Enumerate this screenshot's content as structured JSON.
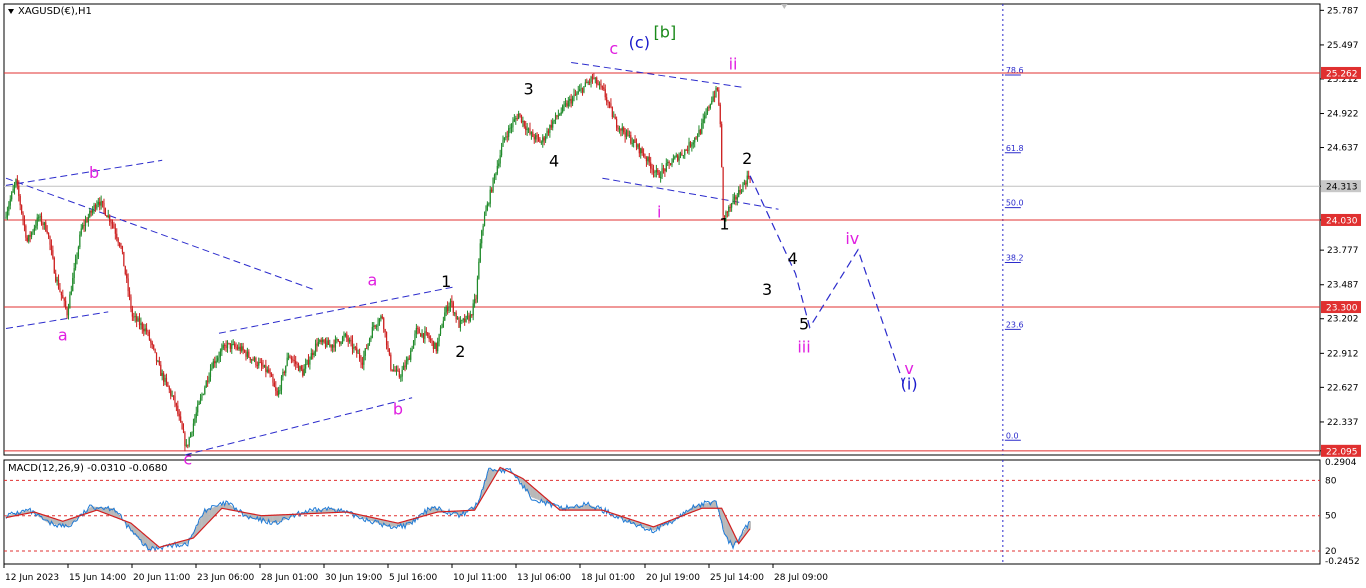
{
  "header": {
    "symbol_label": "XAGUSD(€),H1"
  },
  "macd": {
    "label": "MACD(12,26,9) -0.0310 -0.0680"
  },
  "colors": {
    "up_candle": "#1f8a2a",
    "down_candle": "#cc1f1f",
    "hline": "#e03030",
    "trend": "#2b2bcc",
    "magenta": "#e020e0",
    "wave_blue": "#1a1acc",
    "wave_green": "#1a8a1a",
    "macd_line": "#1e7ad6",
    "signal_line": "#d22020",
    "hist_fill": "#b8b8b8"
  },
  "chart_data": {
    "type": "candlestick",
    "symbol": "XAGUSD(€)",
    "timeframe": "H1",
    "y_ticks": [
      "25.787",
      "25.497",
      "25.212",
      "24.922",
      "24.637",
      "24.313",
      "24.030",
      "23.777",
      "23.487",
      "23.202",
      "22.912",
      "22.627",
      "22.337",
      "22.095"
    ],
    "ylim": [
      22.06,
      25.84
    ],
    "x_tick_labels": [
      "12 Jun 2023",
      "15 Jun 14:00",
      "20 Jun 11:00",
      "23 Jun 06:00",
      "28 Jun 01:00",
      "30 Jun 19:00",
      "5 Jul 16:00",
      "10 Jul 11:00",
      "13 Jul 06:00",
      "18 Jul 01:00",
      "20 Jul 19:00",
      "25 Jul 14:00",
      "28 Jul 09:00"
    ],
    "horizontal_levels": [
      {
        "price": 25.262,
        "label": "25.262"
      },
      {
        "price": 24.03,
        "label": "24.030"
      },
      {
        "price": 23.3,
        "label": "23.300"
      },
      {
        "price": 22.095,
        "label": "22.095"
      }
    ],
    "current_price": {
      "price": 24.313,
      "label": "24.313"
    },
    "price_path": [
      {
        "t": 0,
        "p": 24.05
      },
      {
        "t": 4,
        "p": 24.35
      },
      {
        "t": 8,
        "p": 23.85
      },
      {
        "t": 12,
        "p": 24.05
      },
      {
        "t": 15,
        "p": 23.95
      },
      {
        "t": 18,
        "p": 23.55
      },
      {
        "t": 22,
        "p": 23.25
      },
      {
        "t": 27,
        "p": 23.95
      },
      {
        "t": 33,
        "p": 24.2
      },
      {
        "t": 38,
        "p": 24.0
      },
      {
        "t": 41,
        "p": 23.8
      },
      {
        "t": 45,
        "p": 23.22
      },
      {
        "t": 50,
        "p": 23.1
      },
      {
        "t": 55,
        "p": 22.75
      },
      {
        "t": 60,
        "p": 22.5
      },
      {
        "t": 64,
        "p": 22.12
      },
      {
        "t": 68,
        "p": 22.45
      },
      {
        "t": 73,
        "p": 22.82
      },
      {
        "t": 78,
        "p": 22.98
      },
      {
        "t": 83,
        "p": 22.95
      },
      {
        "t": 88,
        "p": 22.85
      },
      {
        "t": 93,
        "p": 22.75
      },
      {
        "t": 96,
        "p": 22.55
      },
      {
        "t": 100,
        "p": 22.9
      },
      {
        "t": 105,
        "p": 22.75
      },
      {
        "t": 110,
        "p": 23.0
      },
      {
        "t": 115,
        "p": 22.98
      },
      {
        "t": 120,
        "p": 23.05
      },
      {
        "t": 126,
        "p": 22.85
      },
      {
        "t": 130,
        "p": 23.15
      },
      {
        "t": 133,
        "p": 23.22
      },
      {
        "t": 136,
        "p": 22.8
      },
      {
        "t": 139,
        "p": 22.72
      },
      {
        "t": 142,
        "p": 22.85
      },
      {
        "t": 145,
        "p": 23.1
      },
      {
        "t": 149,
        "p": 23.05
      },
      {
        "t": 152,
        "p": 22.95
      },
      {
        "t": 155,
        "p": 23.25
      },
      {
        "t": 157,
        "p": 23.35
      },
      {
        "t": 160,
        "p": 23.15
      },
      {
        "t": 164,
        "p": 23.22
      },
      {
        "t": 166,
        "p": 23.38
      },
      {
        "t": 168,
        "p": 23.95
      },
      {
        "t": 172,
        "p": 24.35
      },
      {
        "t": 176,
        "p": 24.72
      },
      {
        "t": 181,
        "p": 24.92
      },
      {
        "t": 185,
        "p": 24.75
      },
      {
        "t": 189,
        "p": 24.68
      },
      {
        "t": 193,
        "p": 24.85
      },
      {
        "t": 198,
        "p": 25.0
      },
      {
        "t": 203,
        "p": 25.12
      },
      {
        "t": 207,
        "p": 25.22
      },
      {
        "t": 211,
        "p": 25.1
      },
      {
        "t": 215,
        "p": 24.85
      },
      {
        "t": 220,
        "p": 24.72
      },
      {
        "t": 225,
        "p": 24.58
      },
      {
        "t": 230,
        "p": 24.4
      },
      {
        "t": 235,
        "p": 24.52
      },
      {
        "t": 240,
        "p": 24.62
      },
      {
        "t": 245,
        "p": 24.78
      },
      {
        "t": 249,
        "p": 25.05
      },
      {
        "t": 251,
        "p": 25.12
      },
      {
        "t": 252,
        "p": 24.85
      },
      {
        "t": 253,
        "p": 24.05
      },
      {
        "t": 256,
        "p": 24.15
      },
      {
        "t": 259,
        "p": 24.28
      },
      {
        "t": 262,
        "p": 24.4
      }
    ],
    "t_max": 262,
    "projection": [
      {
        "t": 262,
        "p": 24.4
      },
      {
        "t": 278,
        "p": 23.58
      },
      {
        "t": 283,
        "p": 23.13
      },
      {
        "t": 300,
        "p": 23.78
      },
      {
        "t": 316,
        "p": 22.66
      }
    ],
    "trendlines": [
      {
        "t1": 0,
        "p1": 24.32,
        "t2": 55,
        "p2": 24.53
      },
      {
        "t1": 0,
        "p1": 24.38,
        "t2": 108,
        "p2": 23.45
      },
      {
        "t1": 0,
        "p1": 23.12,
        "t2": 36,
        "p2": 23.26
      },
      {
        "t1": 63,
        "p1": 22.06,
        "t2": 143,
        "p2": 22.54
      },
      {
        "t1": 75,
        "p1": 23.08,
        "t2": 158,
        "p2": 23.47
      },
      {
        "t1": 199,
        "p1": 25.35,
        "t2": 260,
        "p2": 25.14
      },
      {
        "t1": 210,
        "p1": 24.38,
        "t2": 272,
        "p2": 24.12
      }
    ],
    "fibonacci": {
      "t": 351,
      "levels": [
        {
          "label": "78.6",
          "price": 25.262
        },
        {
          "label": "61.8",
          "price": 24.61
        },
        {
          "label": "50.0",
          "price": 24.15
        },
        {
          "label": "38.2",
          "price": 23.69
        },
        {
          "label": "23.6",
          "price": 23.13
        },
        {
          "label": "0.0",
          "price": 22.2
        }
      ]
    },
    "wave_labels": [
      {
        "text": "a",
        "t": 20,
        "p": 23.02,
        "color": "magenta"
      },
      {
        "text": "b",
        "t": 31,
        "p": 24.38,
        "color": "magenta"
      },
      {
        "text": "c",
        "t": 64,
        "p": 21.98,
        "color": "magenta"
      },
      {
        "text": "a",
        "t": 129,
        "p": 23.48,
        "color": "magenta"
      },
      {
        "text": "b",
        "t": 138,
        "p": 22.4,
        "color": "magenta"
      },
      {
        "text": "1",
        "t": 155,
        "p": 23.47,
        "color": "black"
      },
      {
        "text": "2",
        "t": 160,
        "p": 22.88,
        "color": "black"
      },
      {
        "text": "3",
        "t": 184,
        "p": 25.08,
        "color": "black"
      },
      {
        "text": "4",
        "t": 193,
        "p": 24.48,
        "color": "black"
      },
      {
        "text": "c",
        "t": 214,
        "p": 25.42,
        "color": "magenta"
      },
      {
        "text": "(c)",
        "t": 223,
        "p": 25.47,
        "color": "wave_blue"
      },
      {
        "text": "[b]",
        "t": 232,
        "p": 25.56,
        "color": "wave_green"
      },
      {
        "text": "ii",
        "t": 256,
        "p": 25.29,
        "color": "magenta"
      },
      {
        "text": "i",
        "t": 230,
        "p": 24.05,
        "color": "magenta"
      },
      {
        "text": "1",
        "t": 253,
        "p": 23.95,
        "color": "black"
      },
      {
        "text": "2",
        "t": 261,
        "p": 24.5,
        "color": "black"
      },
      {
        "text": "3",
        "t": 268,
        "p": 23.4,
        "color": "black"
      },
      {
        "text": "4",
        "t": 277,
        "p": 23.66,
        "color": "black"
      },
      {
        "text": "5",
        "t": 281,
        "p": 23.11,
        "color": "black"
      },
      {
        "text": "iii",
        "t": 281,
        "p": 22.92,
        "color": "magenta"
      },
      {
        "text": "iv",
        "t": 298,
        "p": 23.83,
        "color": "magenta"
      },
      {
        "text": "v",
        "t": 318,
        "p": 22.74,
        "color": "magenta"
      },
      {
        "text": "(i)",
        "t": 318,
        "p": 22.61,
        "color": "wave_blue"
      }
    ],
    "macd_panel": {
      "label": "MACD(12,26,9) -0.0310 -0.0680",
      "y_ticks": [
        "0.2904",
        "80",
        "50",
        "20",
        "-0.2452"
      ],
      "ylim": [
        -0.26,
        0.3
      ],
      "levels": [
        80,
        50,
        20
      ],
      "macd_path": [
        {
          "t": 0,
          "v": 0.0
        },
        {
          "t": 8,
          "v": 0.03
        },
        {
          "t": 15,
          "v": -0.04
        },
        {
          "t": 22,
          "v": -0.06
        },
        {
          "t": 30,
          "v": 0.05
        },
        {
          "t": 38,
          "v": 0.04
        },
        {
          "t": 44,
          "v": -0.08
        },
        {
          "t": 50,
          "v": -0.18
        },
        {
          "t": 58,
          "v": -0.16
        },
        {
          "t": 64,
          "v": -0.15
        },
        {
          "t": 70,
          "v": 0.03
        },
        {
          "t": 78,
          "v": 0.07
        },
        {
          "t": 85,
          "v": -0.01
        },
        {
          "t": 95,
          "v": -0.04
        },
        {
          "t": 105,
          "v": 0.02
        },
        {
          "t": 115,
          "v": 0.04
        },
        {
          "t": 125,
          "v": -0.01
        },
        {
          "t": 135,
          "v": -0.06
        },
        {
          "t": 142,
          "v": -0.05
        },
        {
          "t": 150,
          "v": 0.05
        },
        {
          "t": 160,
          "v": 0.0
        },
        {
          "t": 166,
          "v": 0.06
        },
        {
          "t": 170,
          "v": 0.25
        },
        {
          "t": 178,
          "v": 0.24
        },
        {
          "t": 185,
          "v": 0.1
        },
        {
          "t": 195,
          "v": 0.04
        },
        {
          "t": 205,
          "v": 0.06
        },
        {
          "t": 212,
          "v": 0.02
        },
        {
          "t": 220,
          "v": -0.04
        },
        {
          "t": 228,
          "v": -0.08
        },
        {
          "t": 235,
          "v": -0.03
        },
        {
          "t": 242,
          "v": 0.05
        },
        {
          "t": 250,
          "v": 0.08
        },
        {
          "t": 253,
          "v": -0.1
        },
        {
          "t": 256,
          "v": -0.17
        },
        {
          "t": 262,
          "v": -0.03
        }
      ],
      "signal_path": [
        {
          "t": 0,
          "v": -0.01
        },
        {
          "t": 10,
          "v": 0.02
        },
        {
          "t": 20,
          "v": -0.03
        },
        {
          "t": 32,
          "v": 0.03
        },
        {
          "t": 44,
          "v": -0.04
        },
        {
          "t": 54,
          "v": -0.17
        },
        {
          "t": 66,
          "v": -0.12
        },
        {
          "t": 76,
          "v": 0.04
        },
        {
          "t": 90,
          "v": 0.0
        },
        {
          "t": 105,
          "v": 0.01
        },
        {
          "t": 120,
          "v": 0.02
        },
        {
          "t": 138,
          "v": -0.04
        },
        {
          "t": 152,
          "v": 0.02
        },
        {
          "t": 165,
          "v": 0.03
        },
        {
          "t": 174,
          "v": 0.26
        },
        {
          "t": 182,
          "v": 0.2
        },
        {
          "t": 195,
          "v": 0.03
        },
        {
          "t": 210,
          "v": 0.03
        },
        {
          "t": 228,
          "v": -0.06
        },
        {
          "t": 245,
          "v": 0.04
        },
        {
          "t": 252,
          "v": 0.04
        },
        {
          "t": 258,
          "v": -0.15
        },
        {
          "t": 262,
          "v": -0.07
        }
      ]
    }
  }
}
